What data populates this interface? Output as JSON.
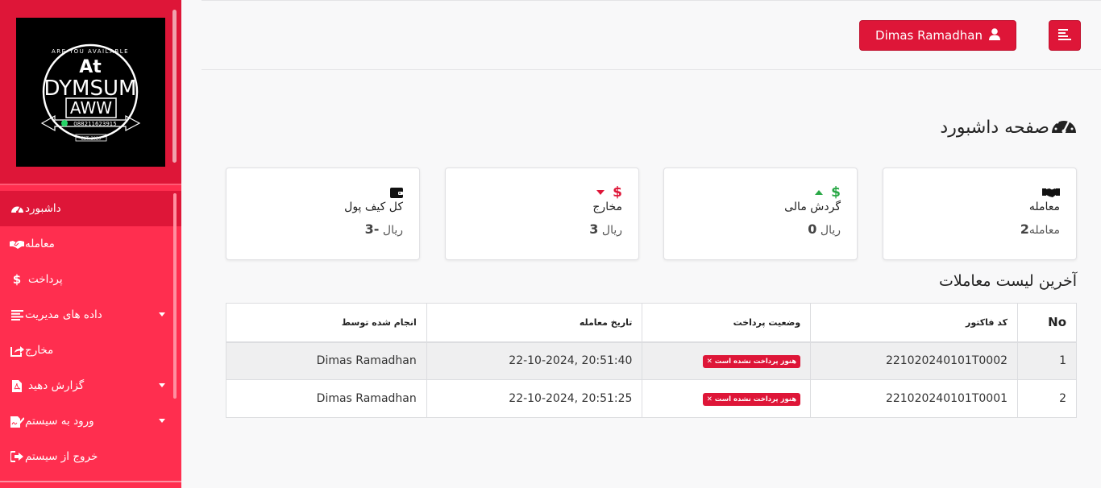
{
  "logo": {
    "line1": "ARE YOU AVAILABLE",
    "line2": "At",
    "line3": "DYMSUM",
    "line4": "AWW",
    "phone": "088211623915",
    "est": "EST. 2020"
  },
  "topbar": {
    "user_label": "Dimas Ramadhan",
    "user_icon": "user-icon",
    "menu_icon": "menu-icon"
  },
  "page": {
    "title": "صفحه داشبورد",
    "title_icon": "dashboard-gauge-icon"
  },
  "sidebar": {
    "items": [
      {
        "label": "داشبورد",
        "icon": "gauge-icon"
      },
      {
        "label": "معامله",
        "icon": "handshake-icon"
      },
      {
        "label": "پرداخت",
        "icon": "dollar-icon"
      },
      {
        "label": "داده های مدیریت",
        "icon": "list-icon"
      },
      {
        "label": "مخارج",
        "icon": "share-out-icon"
      },
      {
        "label": "گزارش دهید",
        "icon": "pdf-icon"
      },
      {
        "label": "ورود به سیستم",
        "icon": "signature-icon"
      },
      {
        "label": "خروج از سیستم",
        "icon": "logout-icon"
      }
    ]
  },
  "cards": [
    {
      "label": "معامله",
      "value": "2",
      "suffix": "معامله",
      "icon": "handshake-icon"
    },
    {
      "label": "گردش مالی",
      "prefix": "ریال",
      "value": "0",
      "icon": "dollar-up-icon"
    },
    {
      "label": "مخارج",
      "prefix": "ریال",
      "value": "3",
      "icon": "dollar-down-icon"
    },
    {
      "label": "کل کیف پول",
      "prefix": "ریال",
      "value": "-3",
      "icon": "wallet-icon"
    }
  ],
  "list_title": "آخرین لیست معاملات",
  "table": {
    "headers": {
      "no": "No",
      "code": "کد فاکتور",
      "status": "وضعیت پرداخت",
      "date": "تاریخ معامله",
      "by": "انجام شده توسط"
    },
    "rows": [
      {
        "no": "1",
        "code": "221020240101T0002",
        "status": "هنوز پرداخت نشده است",
        "date": "22-10-2024, 20:51:40",
        "by": "Dimas Ramadhan"
      },
      {
        "no": "2",
        "code": "221020240101T0001",
        "status": "هنوز پرداخت نشده است",
        "date": "22-10-2024, 20:51:25",
        "by": "Dimas Ramadhan"
      }
    ]
  },
  "colors": {
    "primary": "#de1638",
    "sidebar": "#ff2e4f",
    "green": "#28a745"
  }
}
